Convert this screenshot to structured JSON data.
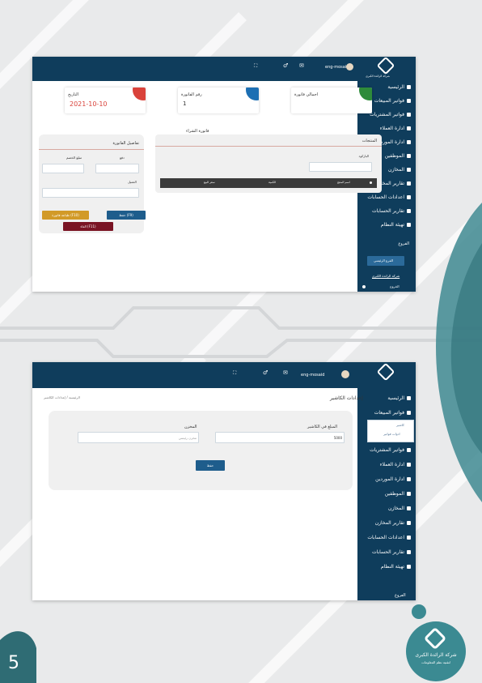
{
  "sidebar1": {
    "brand": "شركة الرائدة الكبرى",
    "items": [
      {
        "label": "الرئيسية",
        "icon": "home-icon"
      },
      {
        "label": "فواتير المبيعات",
        "icon": "gear-icon"
      },
      {
        "label": "فواتير المشتريات",
        "icon": "bag-icon"
      },
      {
        "label": "ادارة العملاء",
        "icon": "chart-icon"
      },
      {
        "label": "ادارة الموردين",
        "icon": "chart-icon"
      },
      {
        "label": "الموظفين",
        "icon": "id-card-icon"
      },
      {
        "label": "المخازن",
        "icon": "grid-icon"
      },
      {
        "label": "تقارير المخازن",
        "icon": "bag-icon"
      },
      {
        "label": "اعدادات الحسابات",
        "icon": "bag-icon"
      },
      {
        "label": "تقارير الحسابات",
        "icon": "bag-icon"
      },
      {
        "label": "تهيئة النظام",
        "icon": "gear-icon"
      }
    ],
    "branches_label": "الفروع",
    "branch_value": "الفرع الرئيسي",
    "company_label": "شركة الرائدة الكبرى",
    "logout_label": "الخروج"
  },
  "screen1": {
    "user": "eng-mosaid",
    "stats": [
      {
        "label": "اجمالي فاتورة",
        "value": "",
        "color": "#2e8b3a"
      },
      {
        "label": "رقم الفاتورة",
        "value": "1",
        "color": "#1c6fb3"
      },
      {
        "label": "التاريخ",
        "value": "2021-10-10",
        "color": "#d9423a"
      }
    ],
    "section_title": "فاتورة الشراء",
    "products_header": "المنتجات",
    "barcode_label": "الباركود",
    "table_headers": [
      "اسم المنتج",
      "الكمية",
      "سعر البيع"
    ],
    "details_header": "تفاصيل الفاتورة",
    "paid_label": "دفع",
    "total_label": "مبلغ الخصم",
    "client_label": "العميل",
    "save_btn": "حفظ (F9)",
    "print_btn": "طباعة فاتورة (F10)",
    "cancel_btn": "الغاء (F11)"
  },
  "sidebar2": {
    "items": [
      {
        "label": "الرئيسية",
        "icon": "home-icon"
      },
      {
        "label": "فواتير المبيعات",
        "icon": "gear-icon"
      },
      {
        "label": "فواتير المشتريات",
        "icon": "bag-icon"
      },
      {
        "label": "ادارة العملاء",
        "icon": "chart-icon"
      },
      {
        "label": "ادارة الموردين",
        "icon": "chart-icon"
      },
      {
        "label": "الموظفين",
        "icon": "id-card-icon"
      },
      {
        "label": "المخازن",
        "icon": "grid-icon"
      },
      {
        "label": "تقارير المخازن",
        "icon": "bag-icon"
      },
      {
        "label": "اعدادات الحسابات",
        "icon": "bag-icon"
      },
      {
        "label": "تقارير الحسابات",
        "icon": "bag-icon"
      },
      {
        "label": "تهيئة النظام",
        "icon": "gear-icon"
      }
    ],
    "sub_items": [
      "كاشير",
      "ادوات فواتير"
    ],
    "branches_label": "الفروع"
  },
  "screen2": {
    "user": "eng-mosaid",
    "page_title": "إعدادات الكاشير",
    "breadcrumb": "الرئيسية / إعدادات الكاشير",
    "amount_label": "المبلغ في الكاشير",
    "amount_value": "5000",
    "store_label": "المخزن",
    "store_value": "مخزن رئيسي",
    "save_btn": "حفظ"
  },
  "footer": {
    "page_number": "5",
    "company_name": "شركة الرائدة الكبرى",
    "company_sub": "لتقنية نظم المعلومات"
  }
}
